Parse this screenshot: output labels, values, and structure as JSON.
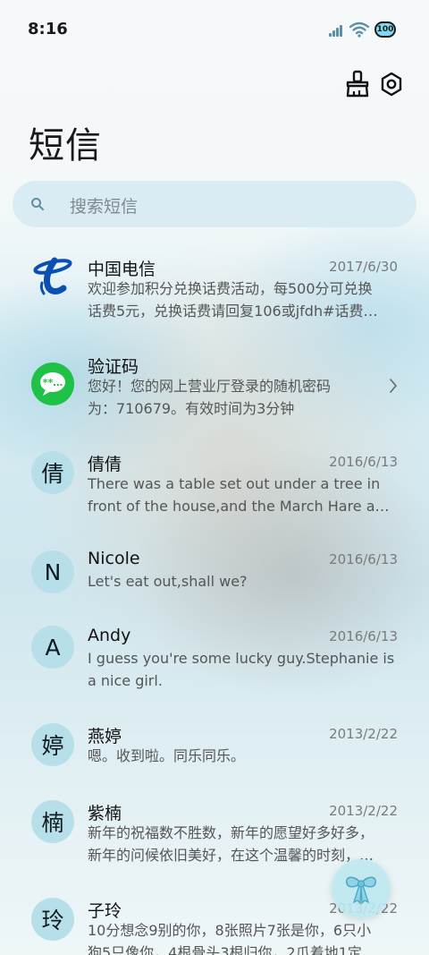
{
  "status_bar": {
    "time": "8:16",
    "battery": "100"
  },
  "header": {
    "title": "短信",
    "cleanup_icon": "broom-icon",
    "settings_icon": "gear-icon"
  },
  "search": {
    "placeholder": "搜索短信"
  },
  "messages": [
    {
      "name": "中国电信",
      "date": "2017/6/30",
      "preview_lines": [
        "欢迎参加积分兑换话费活动，每500分可兑换",
        "话费5元，兑换话费请回复106或jfdh#话费…"
      ],
      "avatar_type": "china-telecom-logo"
    },
    {
      "name": "验证码",
      "date": "",
      "preview_lines": [
        "您好！您的网上营业厅登录的随机密码",
        "为：710679。有效时间为3分钟"
      ],
      "avatar_type": "message-bubble-icon"
    },
    {
      "name": "倩倩",
      "date": "2016/6/13",
      "avatar": "倩",
      "preview_lines": [
        "There was a table set out under a tree in",
        "front of the house,and the March Hare an…"
      ]
    },
    {
      "name": "Nicole",
      "date": "2016/6/13",
      "avatar": "N",
      "preview_lines": [
        "Let's eat out,shall we?"
      ]
    },
    {
      "name": "Andy",
      "date": "2016/6/13",
      "avatar": "A",
      "preview_lines": [
        "I guess you're some lucky guy.Stephanie is",
        "a nice girl."
      ]
    },
    {
      "name": "燕婷",
      "date": "2013/2/22",
      "avatar": "婷",
      "preview_lines": [
        "嗯。收到啦。同乐同乐。"
      ]
    },
    {
      "name": "紫楠",
      "date": "2013/2/22",
      "avatar": "楠",
      "preview_lines": [
        "新年的祝福数不胜数，新年的愿望好多好多，",
        "新年的问候依旧美好，在这个温馨的时刻，…"
      ]
    },
    {
      "name": "子玲",
      "date": "2013/2/22",
      "avatar": "玲",
      "preview_lines": [
        "10分想念9别的你，8张照片7张是你，6只小",
        "狗5只像你，4根骨头3根归你，2爪着地1定"
      ]
    }
  ],
  "fab": {
    "icon": "gift-bow-icon"
  },
  "colors": {
    "avatar_bg": "#b7dfe9",
    "telecom_blue": "#0b4fb3",
    "verify_green": "#1fc146"
  }
}
